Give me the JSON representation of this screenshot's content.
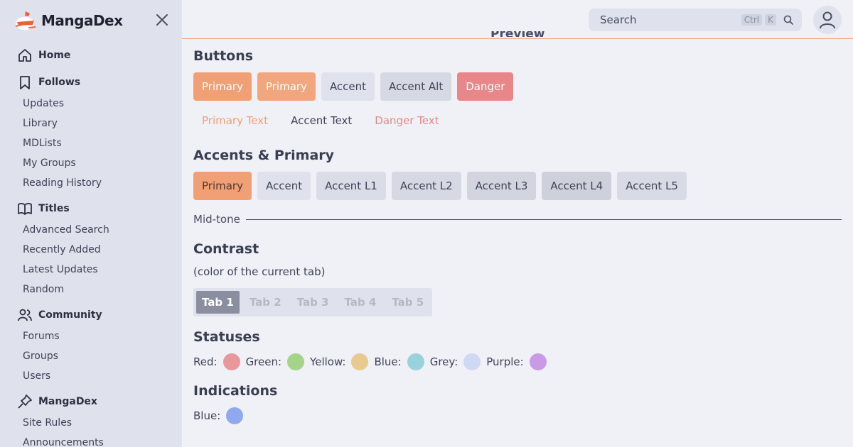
{
  "app": {
    "name": "MangaDex"
  },
  "sidebar": {
    "sections": [
      {
        "label": "Home",
        "icon": "home-icon",
        "items": []
      },
      {
        "label": "Follows",
        "icon": "bookmark-icon",
        "items": [
          "Updates",
          "Library",
          "MDLists",
          "My Groups",
          "Reading History"
        ]
      },
      {
        "label": "Titles",
        "icon": "book-open-icon",
        "items": [
          "Advanced Search",
          "Recently Added",
          "Latest Updates",
          "Random"
        ]
      },
      {
        "label": "Community",
        "icon": "users-icon",
        "items": [
          "Forums",
          "Groups",
          "Users"
        ]
      },
      {
        "label": "MangaDex",
        "icon": "pin-icon",
        "items": [
          "Site Rules",
          "Announcements"
        ]
      }
    ]
  },
  "topbar": {
    "search_label": "Search",
    "kbd_ctrl": "Ctrl",
    "kbd_k": "K"
  },
  "main": {
    "preview_heading": "Preview",
    "buttons_heading": "Buttons",
    "buttons": [
      {
        "label": "Primary",
        "bg": "#f19f74",
        "fg": "#ffffff"
      },
      {
        "label": "Primary",
        "bg": "#f1a67d",
        "fg": "#ffffff"
      },
      {
        "label": "Accent",
        "bg": "#dfe2ec",
        "fg": "#3e4256"
      },
      {
        "label": "Accent Alt",
        "bg": "#d6d9e3",
        "fg": "#3e4256"
      },
      {
        "label": "Danger",
        "bg": "#e8868a",
        "fg": "#ffffff"
      }
    ],
    "text_buttons": [
      {
        "label": "Primary Text",
        "fg": "#f19f74"
      },
      {
        "label": "Accent Text",
        "fg": "#3e4256"
      },
      {
        "label": "Danger Text",
        "fg": "#e8868a"
      }
    ],
    "accents_heading": "Accents & Primary",
    "accents": [
      {
        "label": "Primary",
        "bg": "#f19f74"
      },
      {
        "label": "Accent",
        "bg": "#dfe2ec"
      },
      {
        "label": "Accent L1",
        "bg": "#dadde7"
      },
      {
        "label": "Accent L2",
        "bg": "#d6d9e3"
      },
      {
        "label": "Accent L3",
        "bg": "#d2d5df"
      },
      {
        "label": "Accent L4",
        "bg": "#ced1db"
      },
      {
        "label": "Accent L5",
        "bg": "#d8dbe5"
      }
    ],
    "midtone_label": "Mid-tone",
    "contrast_heading": "Contrast",
    "contrast_note": "(color of the current tab)",
    "tabs": [
      "Tab 1",
      "Tab 2",
      "Tab 3",
      "Tab 4",
      "Tab 5"
    ],
    "active_tab": 0,
    "statuses_heading": "Statuses",
    "statuses": [
      {
        "label": "Red:",
        "color": "#e8989c"
      },
      {
        "label": "Green:",
        "color": "#a4d487"
      },
      {
        "label": "Yellow:",
        "color": "#e8c98e"
      },
      {
        "label": "Blue:",
        "color": "#98d2da"
      },
      {
        "label": "Grey:",
        "color": "#cfd8f4"
      },
      {
        "label": "Purple:",
        "color": "#c99ae6"
      }
    ],
    "indications_heading": "Indications",
    "indications": [
      {
        "label": "Blue:",
        "color": "#8fa8ee"
      }
    ]
  },
  "colors": {
    "primary": "#f19f74",
    "sidebar_bg": "#dfe2ec",
    "page_bg": "#f0f1f6"
  }
}
